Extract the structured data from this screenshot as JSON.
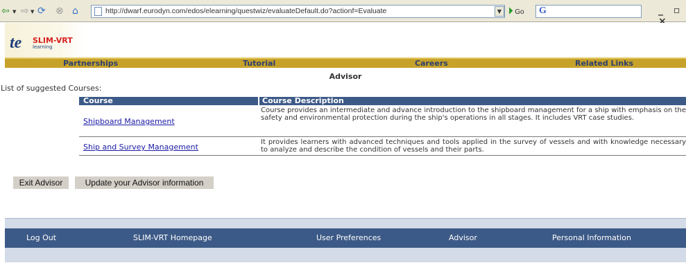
{
  "browser": {
    "url": "http://dwarf.eurodyn.com/edos/elearning/questwiz/evaluateDefault.do?actionf=Evaluate",
    "go_label": "Go",
    "search_logo": "G",
    "window_controls": "_ ▫ ×"
  },
  "logo": {
    "title": "SLIM-VRT",
    "subtitle": "learning"
  },
  "menu": {
    "items": [
      {
        "label": "Partnerships"
      },
      {
        "label": "Tutorial"
      },
      {
        "label": "Careers"
      },
      {
        "label": "Related Links"
      }
    ]
  },
  "main": {
    "section_title": "Advisor",
    "list_label": "List of suggested Courses:",
    "table": {
      "headers": [
        "Course",
        "Course Description"
      ],
      "rows": [
        {
          "course": "Shipboard Management",
          "description": "Course provides an intermediate and advance introduction to the shipboard management for a ship with emphasis on the safety and environmental protection during the ship's operations in all stages. It includes VRT case studies."
        },
        {
          "course": "Ship and Survey Management",
          "description": "It provides learners with advanced techniques and tools applied in the survey of vessels and with knowledge necessary to analyze and describe the condition of vessels and their parts."
        }
      ]
    },
    "buttons": {
      "exit": "Exit Advisor",
      "update": "Update your Advisor information"
    }
  },
  "footer": {
    "items": [
      {
        "label": "Log Out"
      },
      {
        "label": "SLIM-VRT Homepage"
      },
      {
        "label": "User Preferences"
      },
      {
        "label": "Advisor"
      },
      {
        "label": "Personal Information"
      }
    ]
  },
  "colors": {
    "menu_bar": "#c7a22a",
    "header_blue": "#3c5a87",
    "footer_light": "#d3dbe8",
    "link": "#1a1aa6"
  }
}
